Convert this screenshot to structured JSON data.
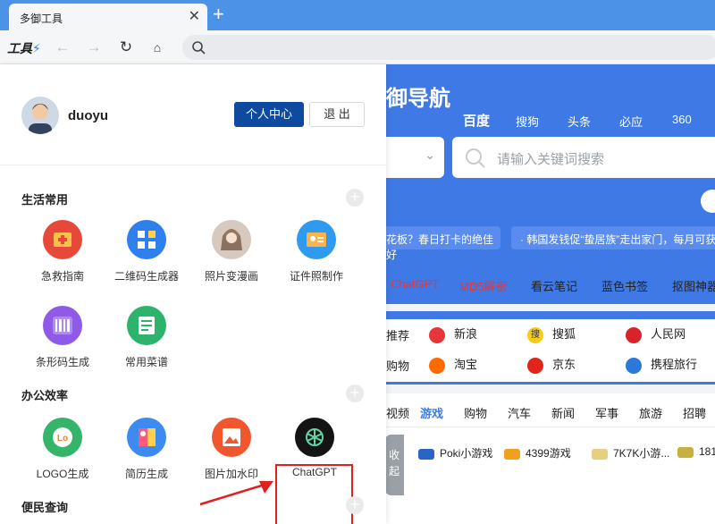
{
  "browser": {
    "tab_title": "多御工具",
    "close_symbol": "✕",
    "newtab_symbol": "+",
    "logo": "工具"
  },
  "user": {
    "name": "duoyu",
    "center_label": "个人中心",
    "logout_label": "退 出"
  },
  "sections": [
    {
      "title": "生活常用",
      "items": [
        {
          "label": "急救指南",
          "color": "#e8483a"
        },
        {
          "label": "二维码生成器",
          "color": "#2f80ed"
        },
        {
          "label": "照片变漫画",
          "color": "#d8c9bf"
        },
        {
          "label": "证件照制作",
          "color": "#2f9bf0"
        },
        {
          "label": "条形码生成",
          "color": "#8f5ae8"
        },
        {
          "label": "常用菜谱",
          "color": "#2db36b"
        }
      ]
    },
    {
      "title": "办公效率",
      "items": [
        {
          "label": "LOGO生成",
          "color": "#35b56a"
        },
        {
          "label": "简历生成",
          "color": "#3d8bf0"
        },
        {
          "label": "图片加水印",
          "color": "#f0572f"
        },
        {
          "label": "ChatGPT",
          "color": "#141414"
        }
      ]
    },
    {
      "title": "便民查询",
      "items": []
    }
  ],
  "side": {
    "brand": "御导航",
    "engines": [
      "百度",
      "搜狗",
      "头条",
      "必应",
      "360"
    ],
    "search_placeholder": "请输入关键词搜索",
    "news": [
      "花板？春日打卡的绝佳好",
      "· 韩国发钱促“蛰居族”走出家门，每月可获金"
    ],
    "quicklinks": [
      "ChatGPT",
      "MD5解密",
      "看云笔记",
      "蓝色书签",
      "抠图神器"
    ],
    "sites_row1": [
      "推荐",
      "新浪",
      "搜狐",
      "人民网"
    ],
    "sites_row2": [
      "购物",
      "淘宝",
      "京东",
      "携程旅行"
    ],
    "site_icon_text": [
      "",
      "",
      "搜",
      ""
    ],
    "game_tabs": [
      "视频",
      "游戏",
      "购物",
      "汽车",
      "新闻",
      "军事",
      "旅游",
      "招聘"
    ],
    "games": [
      "Poki小游戏",
      "4399游戏",
      "7K7K小游...",
      "181"
    ],
    "collapse_label": "收起"
  }
}
